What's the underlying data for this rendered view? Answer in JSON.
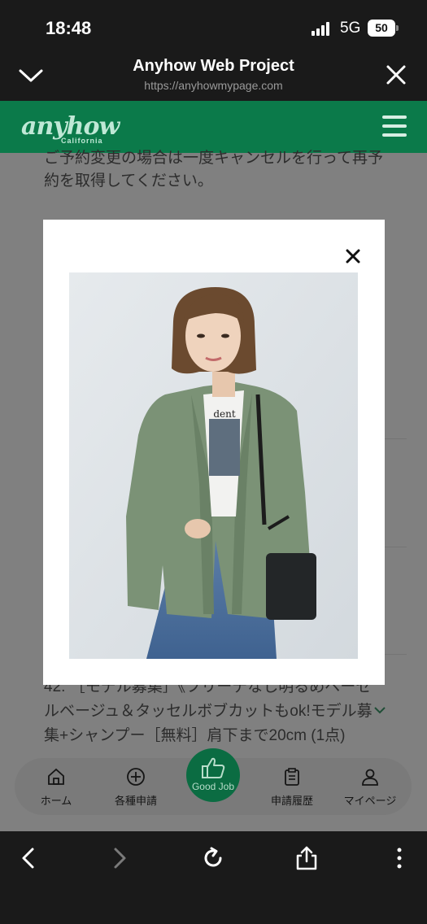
{
  "status_bar": {
    "time": "18:48",
    "network": "5G",
    "battery": "50"
  },
  "browser": {
    "title": "Anyhow Web Project",
    "url": "https://anyhowmypage.com"
  },
  "site": {
    "logo": "anyhow",
    "logo_sub": "California"
  },
  "background_text": {
    "line1": "ご予約変更の場合は一度キャンセルを行って再予",
    "line2": "約を取得してください。",
    "item_line1": "42. ［モデル募集］《フリーデなし明るめベーセ",
    "item_line2": "ルベージュ＆タッセルボブカットもok!モデル募",
    "item_line3": "集+シャンプー［無料］肩下まで20cm (1点)"
  },
  "tabs": {
    "home": "ホーム",
    "apply": "各種申請",
    "good_job": "Good Job",
    "history": "申請履歴",
    "mypage": "マイページ"
  },
  "icons": {
    "signal": "signal-icon",
    "close": "close-icon",
    "chevron": "chevron-down-icon",
    "menu": "menu-icon",
    "home": "home-icon",
    "plus": "plus-circle-icon",
    "thumbs": "thumbs-up-icon",
    "clipboard": "clipboard-icon",
    "user": "user-icon",
    "back": "back-icon",
    "forward": "forward-icon",
    "reload": "reload-icon",
    "share": "share-icon",
    "more": "more-icon"
  },
  "colors": {
    "brand_green": "#14a86a",
    "overlay_dark": "#0b7a4a"
  }
}
